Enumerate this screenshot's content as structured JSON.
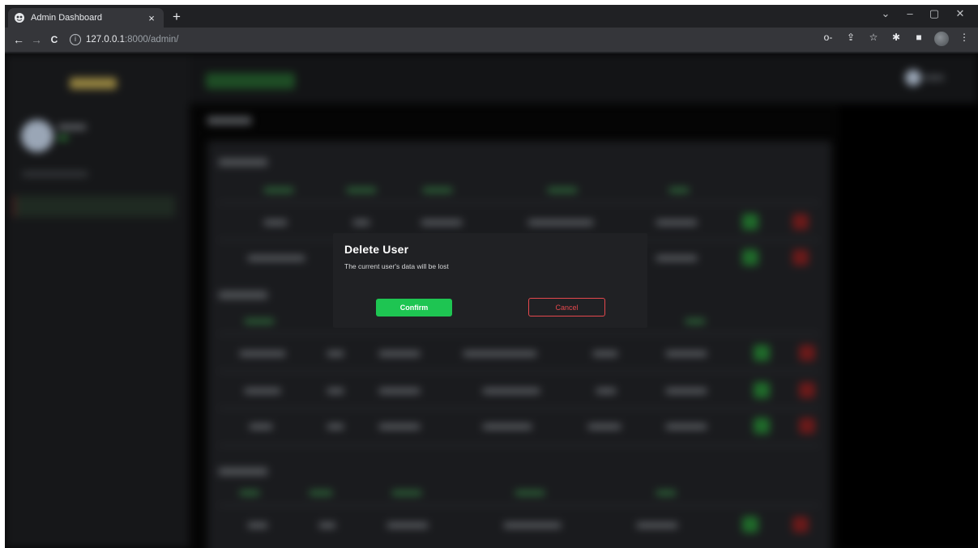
{
  "browser": {
    "tab_title": "Admin Dashboard",
    "tab_close": "×",
    "new_tab": "+",
    "url_host": "127.0.0.1",
    "url_path": ":8000/admin/",
    "nav": {
      "back": "←",
      "forward": "→",
      "reload": "C"
    },
    "window_controls": {
      "tabsearch": "⌄",
      "minimize": "–",
      "restore": "▢",
      "close": "✕"
    },
    "toolbar_icons": {
      "key": "o-",
      "share": "⇪",
      "bookmark": "☆",
      "extensions": "✱",
      "sidepanel": "■",
      "menu": "⋮"
    }
  },
  "modal": {
    "title": "Delete User",
    "message": "The current user's data will be lost",
    "confirm_label": "Confirm",
    "cancel_label": "Cancel"
  },
  "colors": {
    "confirm": "#1ec552",
    "cancel": "#e5484d",
    "modal_bg": "#202124",
    "page_bg": "#050505"
  }
}
